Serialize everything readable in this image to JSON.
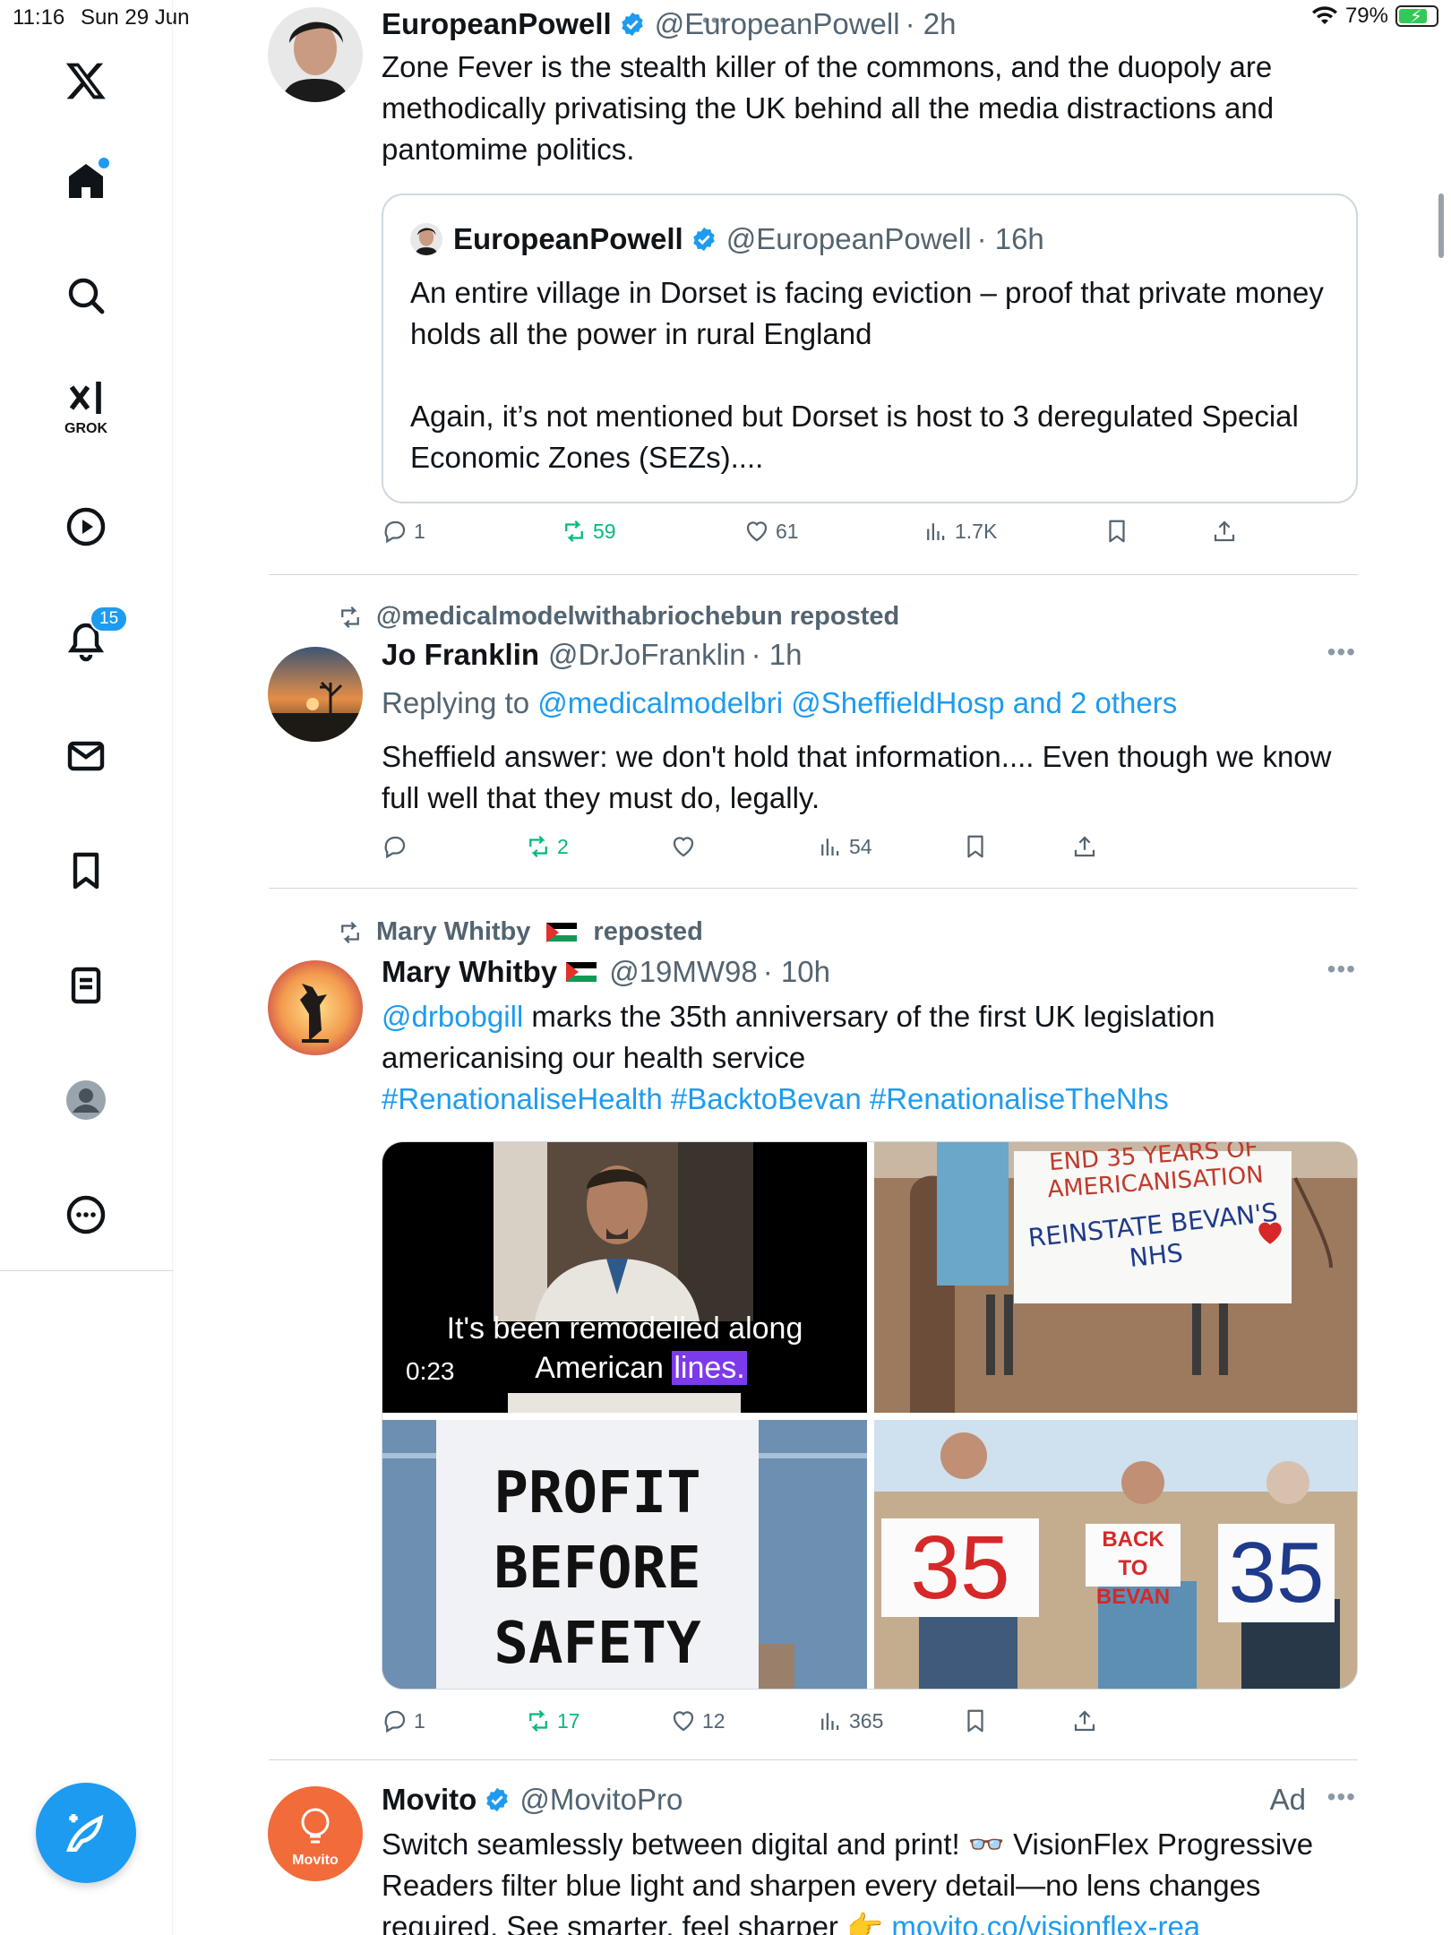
{
  "status_bar": {
    "time": "11:16",
    "date": "Sun 29 Jun",
    "battery": "79%",
    "battery_level": 0.79,
    "top_dots": "•••"
  },
  "sidebar": {
    "notifications_count": "15",
    "grok_label": "GROK",
    "items": [
      "x-logo",
      "home-icon",
      "search-icon",
      "grok-icon",
      "video-icon",
      "bell-icon",
      "mail-icon",
      "bookmark-icon",
      "lists-icon",
      "profile-icon",
      "more-icon"
    ]
  },
  "colors": {
    "accent": "#1d9bf0",
    "repost_green": "#00ba7c",
    "muted": "#536471",
    "divider": "#cfd9de"
  },
  "tweets": [
    {
      "name": "EuropeanPowell",
      "handle": "@EuropeanPowell",
      "time": "· 2h",
      "text": "Zone Fever is the stealth killer of the commons, and the duopoly are methodically privatising the UK behind all the media distractions and pantomime politics.",
      "quote": {
        "name": "EuropeanPowell",
        "handle": "@EuropeanPowell",
        "time": "· 16h",
        "text_1": "An entire village in Dorset is facing eviction – proof that private money holds all the power in rural England",
        "text_2": "Again, it’s not mentioned but Dorset is host to 3 deregulated Special Economic Zones (SEZs)...."
      },
      "replies": "1",
      "reposts": "59",
      "likes": "61",
      "views": "1.7K"
    },
    {
      "repost_by": "@medicalmodelwithabriochebun reposted",
      "name": "Jo Franklin",
      "handle": "@DrJoFranklin",
      "time": "· 1h",
      "more": "•••",
      "replying_prefix": "Replying to",
      "replying_to": "@medicalmodelbri @SheffieldHosp and 2 others",
      "text": "Sheffield answer: we don't hold that information.... Even though we know full well that they must do, legally.",
      "replies": "",
      "reposts": "2",
      "likes": "",
      "views": "54"
    },
    {
      "repost_by_name": "Mary Whitby",
      "repost_suffix": "reposted",
      "name": "Mary Whitby",
      "handle": "@19MW98",
      "time": "· 10h",
      "more": "•••",
      "mention": "@drbobgill",
      "text": " marks the 35th anniversary of the first UK legislation americanising our health service",
      "hashtags": "#RenationaliseHealth #BacktoBevan #RenationaliseTheNhs",
      "media": {
        "video_caption_line1": "It's been remodelled along",
        "video_caption_line2a": "American ",
        "video_caption_line2b": "lines.",
        "video_duration": "0:23",
        "banner_line1": "END 35 YEARS OF",
        "banner_line2": "AMERICANISATION",
        "banner_line3": "REINSTATE BEVAN'S",
        "banner_line4": "NHS",
        "sign_line1": "PROFIT",
        "sign_line2": "BEFORE",
        "sign_line3": "SAFETY",
        "placard_left": "35",
        "placard_middle_1": "BACK TO",
        "placard_middle_2": "BEVAN",
        "placard_right": "35"
      },
      "replies": "1",
      "reposts": "17",
      "likes": "12",
      "views": "365"
    },
    {
      "name": "Movito",
      "handle": "@MovitoPro",
      "ad_label": "Ad",
      "more": "•••",
      "avatar_label": "Movito",
      "text": "Switch seamlessly between digital and print! 👓 VisionFlex Progressive Readers filter blue light and sharpen every detail—no lens changes required. See smarter, feel sharper 👉 ",
      "link": "movito.co/visionflex-rea"
    }
  ]
}
